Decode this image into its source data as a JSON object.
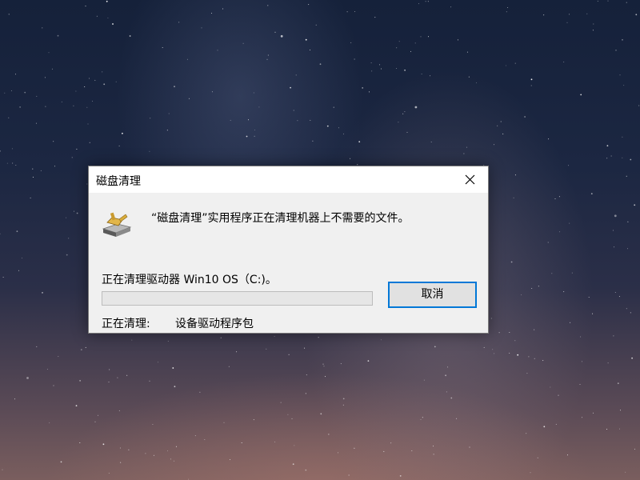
{
  "window": {
    "title": "磁盘清理"
  },
  "dialog": {
    "message": "“磁盘清理”实用程序正在清理机器上不需要的文件。",
    "drive_text": "正在清理驱动器 Win10 OS（C:)。",
    "progress": 0,
    "status_label": "正在清理:",
    "status_value": "设备驱动程序包",
    "cancel_label": "取消"
  },
  "icons": {
    "app": "disk-cleanup-icon",
    "close": "close-icon"
  },
  "colors": {
    "accent": "#0078d7",
    "dialog_bg": "#f0f0f0",
    "progress_fill": "#06b025"
  }
}
